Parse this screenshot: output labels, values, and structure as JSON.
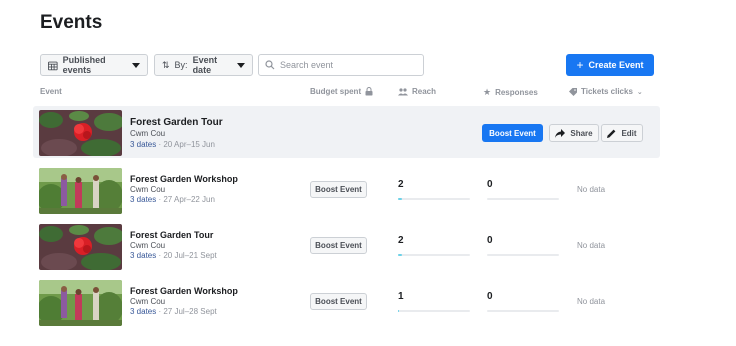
{
  "page_title": "Events",
  "toolbar": {
    "filter_label": "Published events",
    "sort_prefix": "By:",
    "sort_value": "Event date",
    "search_placeholder": "Search event",
    "create_label": "Create Event"
  },
  "columns": {
    "event": "Event",
    "budget": "Budget spent",
    "reach": "Reach",
    "responses": "Responses",
    "tickets": "Tickets clicks"
  },
  "actions": {
    "boost": "Boost Event",
    "share": "Share",
    "edit": "Edit"
  },
  "rows": [
    {
      "name": "Forest Garden Tour",
      "place": "Cwm Cou",
      "dates_link": "3 dates",
      "dates": " · 20 Apr–15 Jun",
      "reach": "",
      "reach_fraction": 0,
      "responses": "",
      "responses_fraction": 0,
      "tickets": ""
    },
    {
      "name": "Forest Garden Workshop",
      "place": "Cwm Cou",
      "dates_link": "3 dates",
      "dates": " · 27 Apr–22 Jun",
      "reach": "2",
      "reach_fraction": 0.05,
      "responses": "0",
      "responses_fraction": 0,
      "tickets": "No data"
    },
    {
      "name": "Forest Garden Tour",
      "place": "Cwm Cou",
      "dates_link": "3 dates",
      "dates": " · 20 Jul–21 Sept",
      "reach": "2",
      "reach_fraction": 0.05,
      "responses": "0",
      "responses_fraction": 0,
      "tickets": "No data"
    },
    {
      "name": "Forest Garden Workshop",
      "place": "Cwm Cou",
      "dates_link": "3 dates",
      "dates": " · 27 Jul–28 Sept",
      "reach": "1",
      "reach_fraction": 0.02,
      "responses": "0",
      "responses_fraction": 0,
      "tickets": "No data"
    }
  ],
  "colors": {
    "accent": "#1877f2",
    "bar_fill": "#6dd2e8",
    "link": "#385898"
  }
}
